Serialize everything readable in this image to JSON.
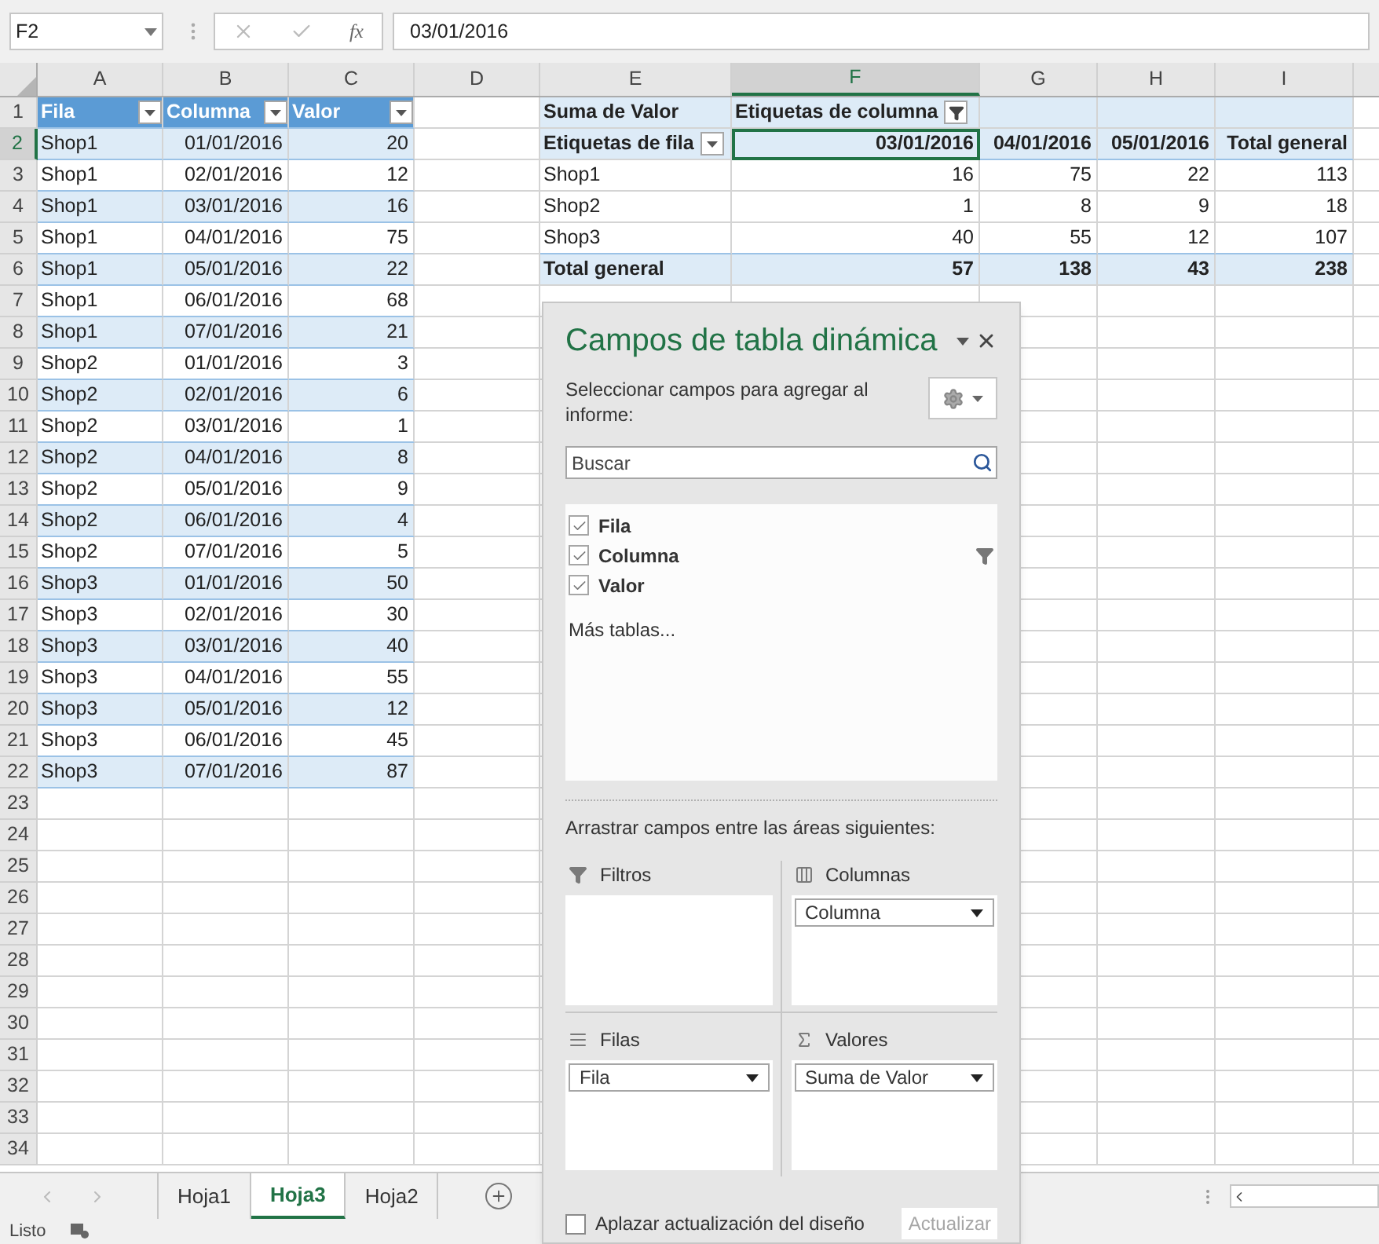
{
  "formula_bar": {
    "name_box": "F2",
    "function_label": "fx",
    "value": "03/01/2016"
  },
  "column_headers": [
    {
      "label": "A",
      "selected": false
    },
    {
      "label": "B",
      "selected": false
    },
    {
      "label": "C",
      "selected": false
    },
    {
      "label": "D",
      "selected": false
    },
    {
      "label": "E",
      "selected": false
    },
    {
      "label": "F",
      "selected": true
    },
    {
      "label": "G",
      "selected": false
    },
    {
      "label": "H",
      "selected": false
    },
    {
      "label": "I",
      "selected": false
    }
  ],
  "row_headers": [
    {
      "label": "1",
      "selected": false
    },
    {
      "label": "2",
      "selected": true
    },
    {
      "label": "3",
      "selected": false
    },
    {
      "label": "4",
      "selected": false
    },
    {
      "label": "5",
      "selected": false
    },
    {
      "label": "6",
      "selected": false
    },
    {
      "label": "7",
      "selected": false
    },
    {
      "label": "8",
      "selected": false
    },
    {
      "label": "9",
      "selected": false
    },
    {
      "label": "10",
      "selected": false
    },
    {
      "label": "11",
      "selected": false
    },
    {
      "label": "12",
      "selected": false
    },
    {
      "label": "13",
      "selected": false
    },
    {
      "label": "14",
      "selected": false
    },
    {
      "label": "15",
      "selected": false
    },
    {
      "label": "16",
      "selected": false
    },
    {
      "label": "17",
      "selected": false
    },
    {
      "label": "18",
      "selected": false
    },
    {
      "label": "19",
      "selected": false
    },
    {
      "label": "20",
      "selected": false
    },
    {
      "label": "21",
      "selected": false
    },
    {
      "label": "22",
      "selected": false
    },
    {
      "label": "23",
      "selected": false
    },
    {
      "label": "24",
      "selected": false
    },
    {
      "label": "25",
      "selected": false
    },
    {
      "label": "26",
      "selected": false
    },
    {
      "label": "27",
      "selected": false
    },
    {
      "label": "28",
      "selected": false
    },
    {
      "label": "29",
      "selected": false
    },
    {
      "label": "30",
      "selected": false
    },
    {
      "label": "31",
      "selected": false
    },
    {
      "label": "32",
      "selected": false
    },
    {
      "label": "33",
      "selected": false
    },
    {
      "label": "34",
      "selected": false
    }
  ],
  "source_table": {
    "columns": [
      "Fila",
      "Columna",
      "Valor"
    ],
    "rows": [
      [
        "Shop1",
        "01/01/2016",
        "20"
      ],
      [
        "Shop1",
        "02/01/2016",
        "12"
      ],
      [
        "Shop1",
        "03/01/2016",
        "16"
      ],
      [
        "Shop1",
        "04/01/2016",
        "75"
      ],
      [
        "Shop1",
        "05/01/2016",
        "22"
      ],
      [
        "Shop1",
        "06/01/2016",
        "68"
      ],
      [
        "Shop1",
        "07/01/2016",
        "21"
      ],
      [
        "Shop2",
        "01/01/2016",
        "3"
      ],
      [
        "Shop2",
        "02/01/2016",
        "6"
      ],
      [
        "Shop2",
        "03/01/2016",
        "1"
      ],
      [
        "Shop2",
        "04/01/2016",
        "8"
      ],
      [
        "Shop2",
        "05/01/2016",
        "9"
      ],
      [
        "Shop2",
        "06/01/2016",
        "4"
      ],
      [
        "Shop2",
        "07/01/2016",
        "5"
      ],
      [
        "Shop3",
        "01/01/2016",
        "50"
      ],
      [
        "Shop3",
        "02/01/2016",
        "30"
      ],
      [
        "Shop3",
        "03/01/2016",
        "40"
      ],
      [
        "Shop3",
        "04/01/2016",
        "55"
      ],
      [
        "Shop3",
        "05/01/2016",
        "12"
      ],
      [
        "Shop3",
        "06/01/2016",
        "45"
      ],
      [
        "Shop3",
        "07/01/2016",
        "87"
      ]
    ]
  },
  "pivot": {
    "value_label": "Suma de Valor",
    "column_labels": "Etiquetas de columna",
    "row_labels": "Etiquetas de fila",
    "columns": [
      {
        "label": "03/01/2016",
        "selected": true
      },
      {
        "label": "04/01/2016",
        "selected": false
      },
      {
        "label": "05/01/2016",
        "selected": false
      },
      {
        "label": "Total general",
        "selected": false
      }
    ],
    "rows": [
      {
        "label": "Shop1",
        "values": [
          "16",
          "75",
          "22",
          "113"
        ]
      },
      {
        "label": "Shop2",
        "values": [
          "1",
          "8",
          "9",
          "18"
        ]
      },
      {
        "label": "Shop3",
        "values": [
          "40",
          "55",
          "12",
          "107"
        ]
      }
    ],
    "total": {
      "label": "Total general",
      "values": [
        "57",
        "138",
        "43",
        "238"
      ]
    }
  },
  "field_list": {
    "title": "Campos de tabla dinámica",
    "subtitle": "Seleccionar campos para agregar al informe:",
    "search": {
      "placeholder": "Buscar"
    },
    "fields": [
      {
        "label": "Fila",
        "checked": true,
        "filtered": false
      },
      {
        "label": "Columna",
        "checked": true,
        "filtered": true
      },
      {
        "label": "Valor",
        "checked": true,
        "filtered": false
      }
    ],
    "more_tables": "Más tablas...",
    "areas_hint": "Arrastrar campos entre las áreas siguientes:",
    "areas": [
      {
        "kind": "filters",
        "label": "Filtros"
      },
      {
        "kind": "columns",
        "label": "Columnas",
        "items": [
          "Columna"
        ]
      },
      {
        "kind": "rows",
        "label": "Filas",
        "items": [
          "Fila"
        ]
      },
      {
        "kind": "values",
        "label": "Valores",
        "items": [
          "Suma de Valor"
        ]
      }
    ],
    "defer_update": {
      "label": "Aplazar actualización del diseño",
      "checked": false
    },
    "update_button": {
      "label": "Actualizar",
      "disabled": true
    }
  },
  "sheet_tabs": [
    {
      "label": "Hoja1",
      "selected": false
    },
    {
      "label": "Hoja3",
      "selected": true
    },
    {
      "label": "Hoja2",
      "selected": false
    }
  ],
  "status_bar": {
    "text": "Listo"
  }
}
